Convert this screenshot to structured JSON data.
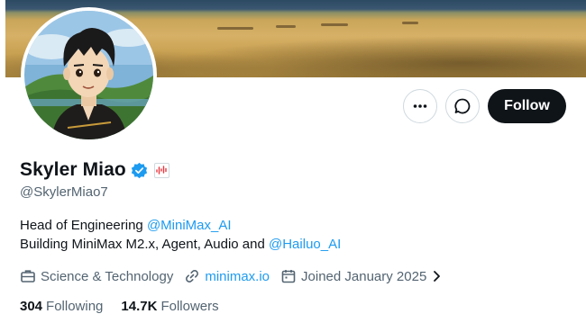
{
  "profile": {
    "display_name": "Skyler Miao",
    "handle": "@SkylerMiao7",
    "bio_line1_text": "Head of Engineering ",
    "bio_line1_mention": "@MiniMax_AI",
    "bio_line2_text": "Building MiniMax M2.x, Agent, Audio and ",
    "bio_line2_mention": "@Hailuo_AI"
  },
  "actions": {
    "follow_label": "Follow",
    "more_icon": "more-dots-icon",
    "message_icon": "message-bubble-icon"
  },
  "meta": {
    "category": "Science & Technology",
    "website": "minimax.io",
    "joined": "Joined January 2025"
  },
  "stats": {
    "following_count": "304",
    "following_label": "Following",
    "followers_count": "14.7K",
    "followers_label": "Followers"
  },
  "colors": {
    "link": "#1d9bf0",
    "verified": "#1d9bf0",
    "follow_bg": "#0f1419"
  }
}
